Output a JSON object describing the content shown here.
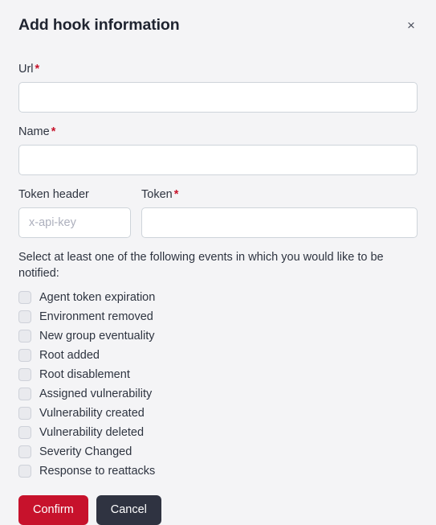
{
  "modal": {
    "title": "Add hook information",
    "close_label": "×"
  },
  "form": {
    "url": {
      "label": "Url",
      "required_marker": "*",
      "value": "",
      "placeholder": ""
    },
    "name": {
      "label": "Name",
      "required_marker": "*",
      "value": "",
      "placeholder": ""
    },
    "token_header": {
      "label": "Token header",
      "value": "",
      "placeholder": "x-api-key"
    },
    "token": {
      "label": "Token",
      "required_marker": "*",
      "value": "",
      "placeholder": ""
    }
  },
  "events": {
    "intro": "Select at least one of the following events in which you would like to be notified:",
    "items": [
      {
        "label": "Agent token expiration",
        "checked": false
      },
      {
        "label": "Environment removed",
        "checked": false
      },
      {
        "label": "New group eventuality",
        "checked": false
      },
      {
        "label": "Root added",
        "checked": false
      },
      {
        "label": "Root disablement",
        "checked": false
      },
      {
        "label": "Assigned vulnerability",
        "checked": false
      },
      {
        "label": "Vulnerability created",
        "checked": false
      },
      {
        "label": "Vulnerability deleted",
        "checked": false
      },
      {
        "label": "Severity Changed",
        "checked": false
      },
      {
        "label": "Response to reattacks",
        "checked": false
      }
    ]
  },
  "footer": {
    "confirm_label": "Confirm",
    "cancel_label": "Cancel"
  },
  "colors": {
    "background": "#f4f4f6",
    "confirm": "#c7122c",
    "cancel": "#2f3341",
    "required": "#c7142c",
    "input_border": "#ced4da",
    "checkbox_fill": "#e9eaee"
  }
}
